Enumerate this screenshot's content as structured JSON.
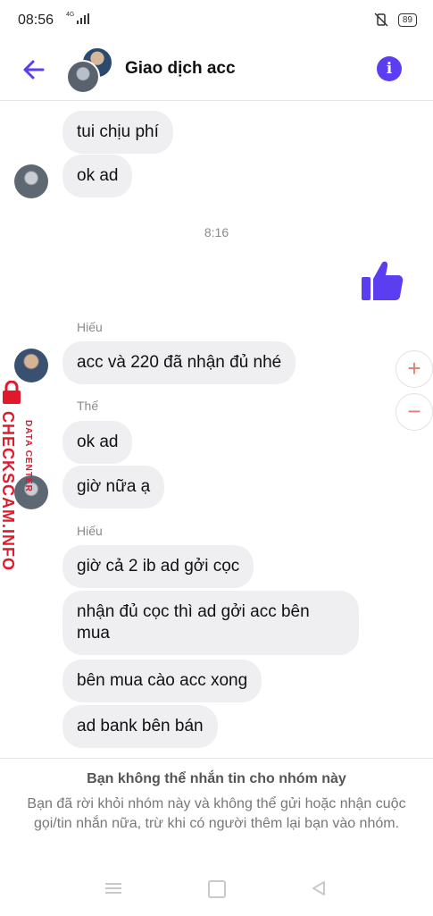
{
  "status_bar": {
    "time": "08:56",
    "network": "4G",
    "battery": "89"
  },
  "header": {
    "title": "Giao dịch acc",
    "accent_color": "#5b3ef0"
  },
  "messages": [
    {
      "text": "tui chịu phí"
    },
    {
      "text": "ok ad"
    },
    {
      "text": "acc và 220 đã nhận đủ nhé"
    },
    {
      "text": "ok ad"
    },
    {
      "text": "giờ nữa ạ"
    },
    {
      "text": "giờ cả 2 ib ad gởi cọc"
    },
    {
      "text": "nhận đủ cọc thì ad gởi acc bên mua"
    },
    {
      "text": "bên mua cào acc xong"
    },
    {
      "text": "ad bank bên bán"
    }
  ],
  "timestamp": "8:16",
  "senders": {
    "hieu_1": "Hiếu",
    "the": "Thế",
    "hieu_2": "Hiếu"
  },
  "zoom": {
    "plus": "+",
    "minus": "−"
  },
  "watermark": {
    "main": "CHECKSCAM.INFO",
    "sub": "DATA CENTER"
  },
  "footer": {
    "title": "Bạn không thể nhắn tin cho nhóm này",
    "body": "Bạn đã rời khỏi nhóm này và không thể gửi hoặc nhận cuộc gọi/tin nhắn nữa, trừ khi có người thêm lại bạn vào nhóm."
  },
  "icons": {
    "back": "arrow-left-icon",
    "info": "info-icon",
    "like": "thumbs-up-icon"
  }
}
